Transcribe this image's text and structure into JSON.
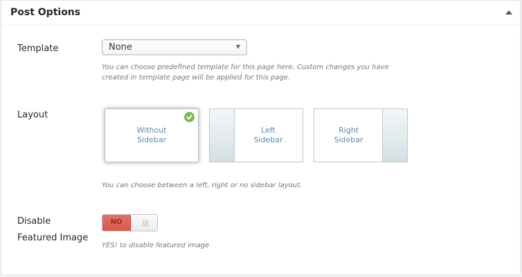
{
  "panel": {
    "title": "Post Options"
  },
  "template": {
    "label": "Template",
    "selected_value": "None",
    "description_line1": "You can choose predefined template for this page here. Custom changes you have",
    "description_line2": "created in template page will be applied for this page."
  },
  "layout": {
    "label": "Layout",
    "options": [
      {
        "line1": "Without",
        "line2": "Sidebar",
        "selected": true
      },
      {
        "line1": "Left",
        "line2": "Sidebar",
        "selected": false
      },
      {
        "line1": "Right",
        "line2": "Sidebar",
        "selected": false
      }
    ],
    "description": "You can choose between a left, right or no sidebar layout."
  },
  "featured_image": {
    "label_line1": "Disable",
    "label_line2": "Featured Image",
    "toggle_state_label": "NO",
    "description": "YES! to disable featured image"
  },
  "colors": {
    "toggle_off": "#d9574a",
    "check_green": "#7aba5d",
    "layout_text": "#5a8aa8"
  }
}
